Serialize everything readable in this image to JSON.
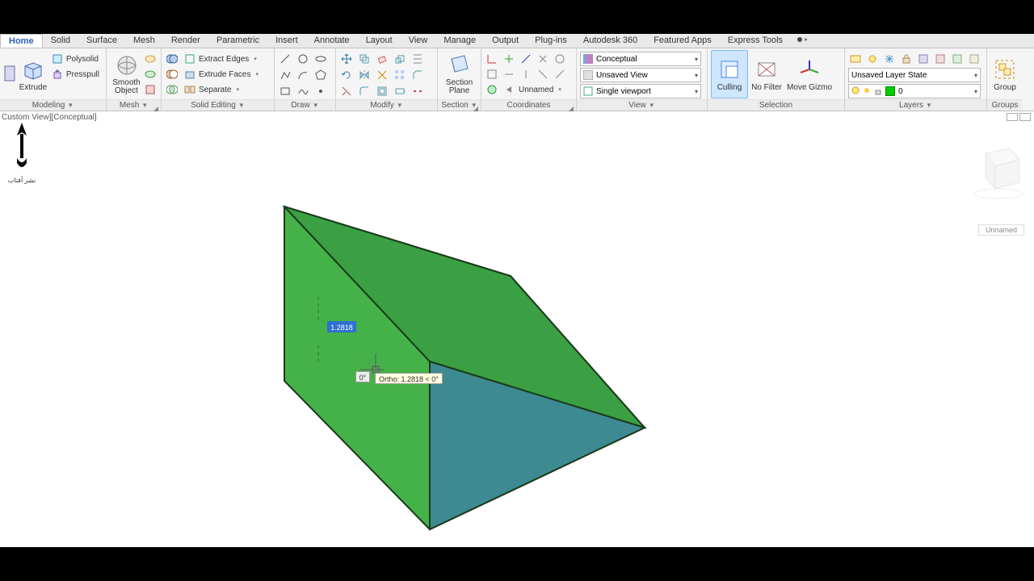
{
  "tabs": {
    "items": [
      "Home",
      "Solid",
      "Surface",
      "Mesh",
      "Render",
      "Parametric",
      "Insert",
      "Annotate",
      "Layout",
      "View",
      "Manage",
      "Output",
      "Plug-ins",
      "Autodesk 360",
      "Featured Apps",
      "Express Tools"
    ],
    "active": 0
  },
  "ribbon": {
    "modeling": {
      "title": "Modeling",
      "extrude": "Extrude",
      "polysolid": "Polysolid",
      "presspull": "Presspull",
      "smooth": "Smooth\nObject"
    },
    "mesh": {
      "title": "Mesh"
    },
    "solid_editing": {
      "title": "Solid Editing",
      "extract_edges": "Extract Edges",
      "extrude_faces": "Extrude Faces",
      "separate": "Separate"
    },
    "draw": {
      "title": "Draw"
    },
    "modify": {
      "title": "Modify"
    },
    "section": {
      "title": "Section",
      "plane": "Section\nPlane"
    },
    "coordinates": {
      "title": "Coordinates",
      "unnamed": "Unnamed"
    },
    "view": {
      "title": "View",
      "visual_style": "Conceptual",
      "saved_view": "Unsaved View",
      "viewport": "Single viewport"
    },
    "selection": {
      "title": "Selection",
      "culling": "Culling",
      "nofilter": "No Filter",
      "movegizmo": "Move Gizmo"
    },
    "layers": {
      "title": "Layers",
      "state": "Unsaved Layer State",
      "current": "0"
    },
    "groups": {
      "title": "Groups",
      "group": "Group"
    }
  },
  "viewport": {
    "label": "Custom View][Conceptual]",
    "nav_label": "Unnamed",
    "input_distance": "1.2818",
    "input_angle": "0°",
    "tooltip": "Ortho: 1.2818 < 0°"
  }
}
